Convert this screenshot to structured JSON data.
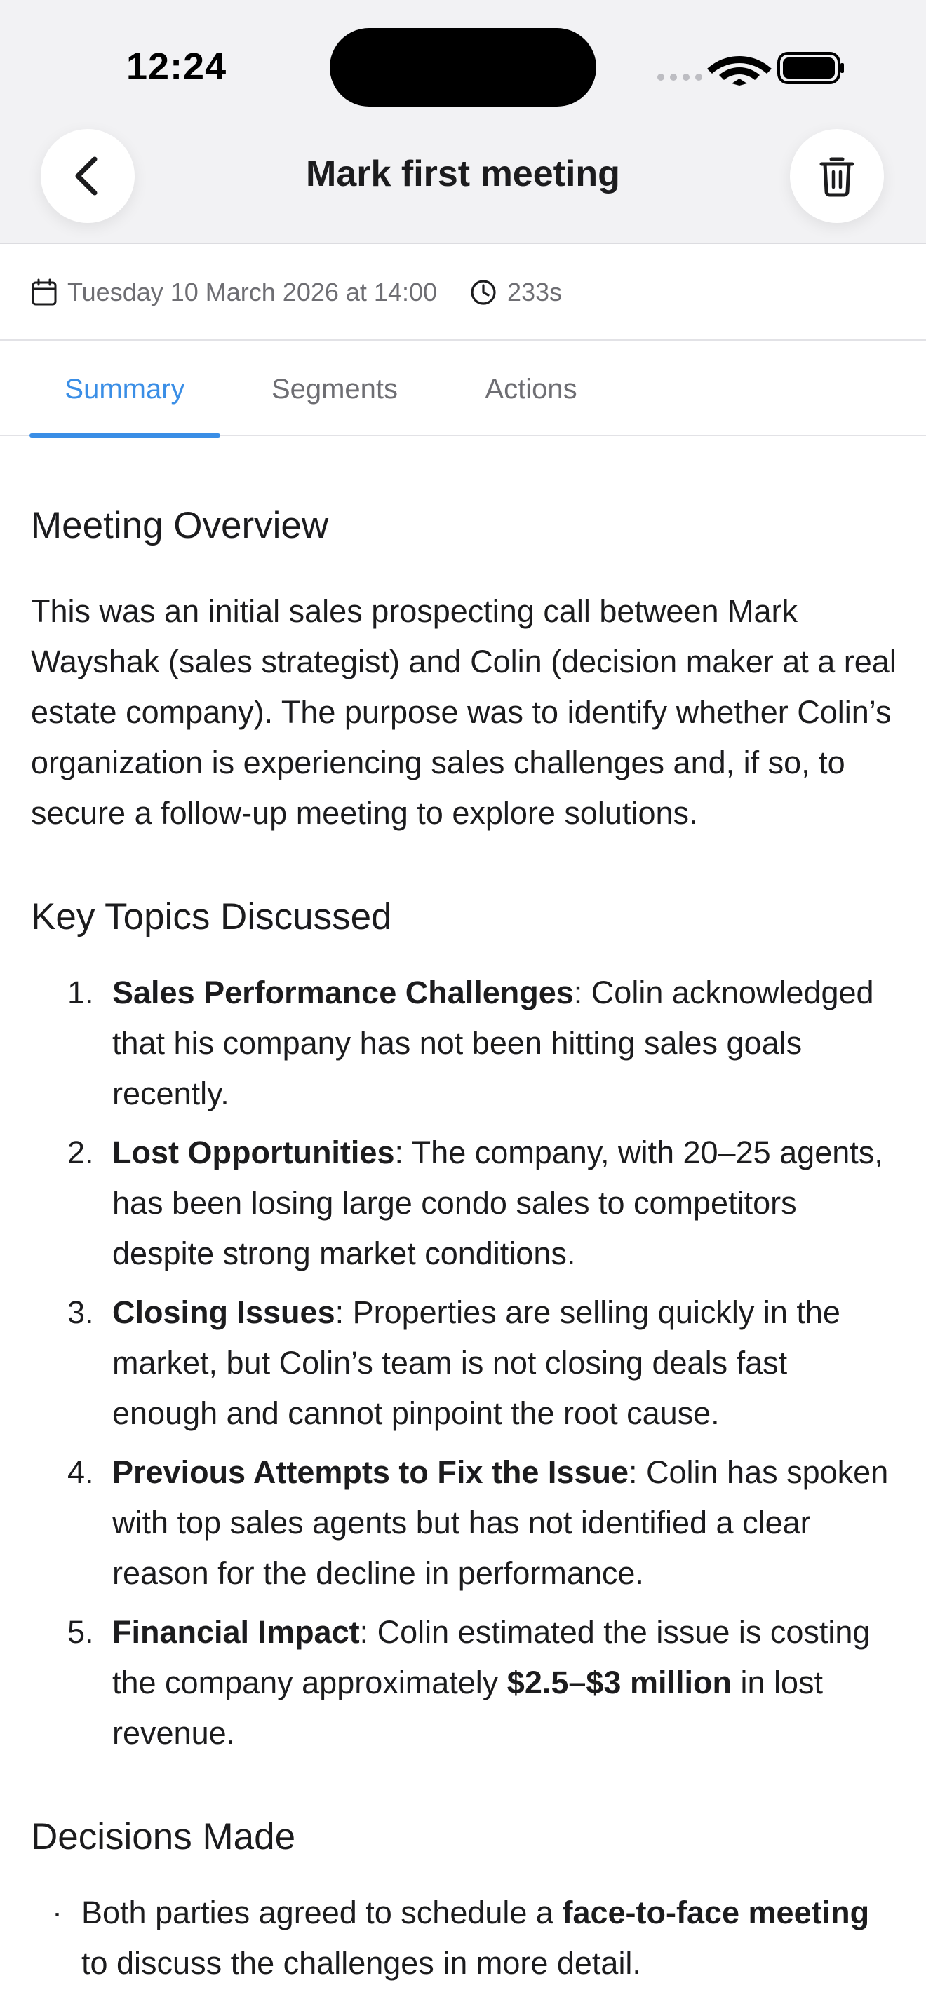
{
  "status_bar": {
    "time": "12:24"
  },
  "header": {
    "title": "Mark first meeting",
    "back_icon": "chevron-left-icon",
    "delete_icon": "trash-icon"
  },
  "meta": {
    "date": "Tuesday 10 March 2026 at 14:00",
    "duration": "233s"
  },
  "tabs": [
    {
      "label": "Summary",
      "active": true
    },
    {
      "label": "Segments",
      "active": false
    },
    {
      "label": "Actions",
      "active": false
    }
  ],
  "summary": {
    "overview_heading": "Meeting Overview",
    "overview_text": "This was an initial sales prospecting call between Mark Wayshak (sales strategist) and Colin (decision maker at a real estate company). The purpose was to identify whether Colin’s organization is experiencing sales challenges and, if so, to secure a follow-up meeting to explore solutions.",
    "topics_heading": "Key Topics Discussed",
    "topics": [
      {
        "num": "1.",
        "title": "Sales Performance Challenges",
        "text": ": Colin acknowledged that his company has not been hitting sales goals recently."
      },
      {
        "num": "2.",
        "title": "Lost Opportunities",
        "text": ": The company, with 20–25 agents, has been losing large condo sales to competitors despite strong market conditions."
      },
      {
        "num": "3.",
        "title": "Closing Issues",
        "text": ": Properties are selling quickly in the market, but Colin’s team is not closing deals fast enough and cannot pinpoint the root cause."
      },
      {
        "num": "4.",
        "title": "Previous Attempts to Fix the Issue",
        "text": ": Colin has spoken with top sales agents but has not identified a clear reason for the decline in performance."
      },
      {
        "num": "5.",
        "title": "Financial Impact",
        "text_before": ": Colin estimated the issue is costing the company approximately ",
        "bold_value": "$2.5–$3 million",
        "text_after": " in lost revenue."
      }
    ],
    "decisions_heading": "Decisions Made",
    "decisions": [
      {
        "bullet": "·",
        "text_before": "Both parties agreed to schedule a ",
        "bold": "face-to-face meeting",
        "text_after": " to discuss the challenges in more detail."
      }
    ]
  }
}
